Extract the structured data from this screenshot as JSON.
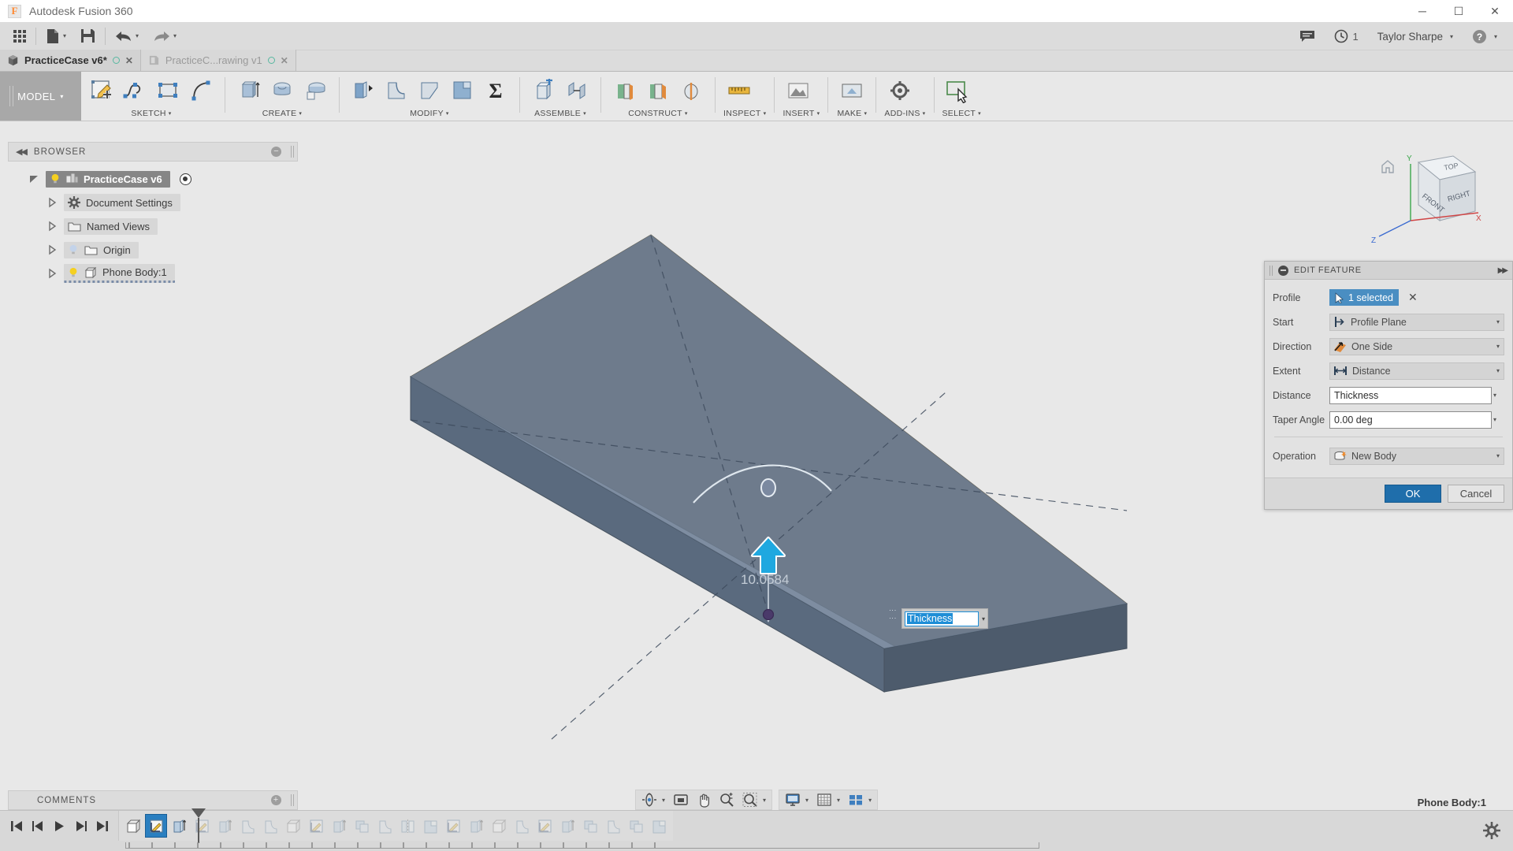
{
  "window": {
    "title": "Autodesk Fusion 360",
    "logo_glyph": "F",
    "controls": {
      "minimize": "─",
      "maximize": "☐",
      "close": "✕"
    }
  },
  "quick_access": {
    "items": [
      {
        "name": "app-grid",
        "icon": "grid-icon",
        "label": ""
      },
      {
        "name": "new-document",
        "icon": "file-icon",
        "label": "",
        "has_caret": true
      },
      {
        "name": "save",
        "icon": "save-icon",
        "label": ""
      },
      {
        "name": "undo",
        "icon": "undo-icon",
        "label": "",
        "has_caret": true
      },
      {
        "name": "redo",
        "icon": "redo-icon",
        "label": "",
        "has_caret": true
      }
    ],
    "right": {
      "comments_icon": "comment-icon",
      "jobs_icon": "clock-icon",
      "jobs_count": "1",
      "user_name": "Taylor Sharpe",
      "help_icon": "help-icon"
    }
  },
  "document_tabs": [
    {
      "label": "PracticeCase v6*",
      "active": true,
      "icon": "cube-icon",
      "status_dot": "○",
      "close": "✕"
    },
    {
      "label": "PracticeC...rawing v1",
      "active": false,
      "icon": "drawing-icon",
      "status_dot": "○",
      "close": "✕"
    }
  ],
  "ribbon": {
    "workspace": {
      "label": "MODEL",
      "caret": "▾"
    },
    "groups": [
      {
        "label": "SKETCH",
        "caret": "▾",
        "tools": [
          "create-sketch",
          "spline",
          "rectangle",
          "arc"
        ]
      },
      {
        "label": "CREATE",
        "caret": "▾",
        "tools": [
          "extrude",
          "revolve",
          "sweep"
        ]
      },
      {
        "label": "MODIFY",
        "caret": "▾",
        "tools": [
          "press-pull",
          "fillet",
          "chamfer",
          "shell",
          "combine",
          "sigma-parameters"
        ]
      },
      {
        "label": "ASSEMBLE",
        "caret": "▾",
        "tools": [
          "new-component",
          "joint"
        ]
      },
      {
        "label": "CONSTRUCT",
        "caret": "▾",
        "tools": [
          "offset-plane",
          "plane-at-angle",
          "axis"
        ]
      },
      {
        "label": "INSPECT",
        "caret": "▾",
        "tools": [
          "measure"
        ]
      },
      {
        "label": "INSERT",
        "caret": "▾",
        "tools": [
          "insert-mesh"
        ]
      },
      {
        "label": "MAKE",
        "caret": "▾",
        "tools": [
          "3d-print"
        ]
      },
      {
        "label": "ADD-INS",
        "caret": "▾",
        "tools": [
          "scripts-addins"
        ]
      },
      {
        "label": "SELECT",
        "caret": "▾",
        "tools": [
          "select-cursor"
        ]
      }
    ]
  },
  "browser": {
    "header": "BROWSER",
    "collapse_icon": "collapse-left-icon",
    "minimize_icon": "minimize-icon",
    "tree": [
      {
        "label": "PracticeCase v6",
        "depth": 0,
        "selected": true,
        "expander": "open",
        "has_bulb": true,
        "bulb": "on",
        "icon": "component-icon",
        "has_radio": true
      },
      {
        "label": "Document Settings",
        "depth": 1,
        "selected": false,
        "expander": "closed",
        "has_bulb": false,
        "icon": "gear-icon",
        "has_radio": false
      },
      {
        "label": "Named Views",
        "depth": 1,
        "selected": false,
        "expander": "closed",
        "has_bulb": false,
        "icon": "folder-icon",
        "has_radio": false
      },
      {
        "label": "Origin",
        "depth": 1,
        "selected": false,
        "expander": "closed",
        "has_bulb": true,
        "bulb": "off",
        "icon": "folder-icon",
        "has_radio": false
      },
      {
        "label": "Phone Body:1",
        "depth": 1,
        "selected": false,
        "highlighted": true,
        "expander": "closed",
        "has_bulb": true,
        "bulb": "on",
        "icon": "body-icon",
        "has_radio": false
      }
    ]
  },
  "canvas": {
    "dimension_value": "10.0584",
    "manipulator_arrow": "up-arrow-handle",
    "rotate_handle": "taper-rotate-handle",
    "input": {
      "value": "Thickness",
      "caret": "▾"
    },
    "view_cube": {
      "top": "TOP",
      "front": "FRONT",
      "right": "RIGHT",
      "axis_x": "X",
      "axis_y": "Y",
      "axis_z": "Z"
    }
  },
  "dialog": {
    "title": "EDIT FEATURE",
    "collapse_icon": "collapse-icon",
    "expand_icon": "expand-right-icon",
    "rows": [
      {
        "label": "Profile",
        "type": "selection",
        "value": "1 selected",
        "icon": "cursor-arrow-icon",
        "clear": "✕"
      },
      {
        "label": "Start",
        "type": "dropdown",
        "value": "Profile Plane",
        "icon": "profile-plane-icon"
      },
      {
        "label": "Direction",
        "type": "dropdown",
        "value": "One Side",
        "icon": "one-side-icon"
      },
      {
        "label": "Extent",
        "type": "dropdown",
        "value": "Distance",
        "icon": "distance-icon"
      },
      {
        "label": "Distance",
        "type": "textinput",
        "value": "Thickness"
      },
      {
        "label": "Taper Angle",
        "type": "textinput",
        "value": "0.00 deg"
      },
      {
        "label": "Operation",
        "type": "dropdown",
        "value": "New Body",
        "icon": "new-body-icon",
        "after_divider": true
      }
    ],
    "ok_label": "OK",
    "cancel_label": "Cancel"
  },
  "comments": {
    "label": "COMMENTS",
    "add_icon": "add-icon"
  },
  "navbar": [
    {
      "name": "orbit",
      "icon": "orbit-icon",
      "caret": true
    },
    {
      "name": "look-at",
      "icon": "look-at-icon",
      "caret": false
    },
    {
      "name": "pan",
      "icon": "pan-hand-icon",
      "caret": false
    },
    {
      "name": "zoom",
      "icon": "zoom-icon",
      "caret": false
    },
    {
      "name": "fit",
      "icon": "fit-window-icon",
      "caret": true
    },
    {
      "name": "display-settings",
      "icon": "monitor-icon",
      "caret": true
    },
    {
      "name": "grid-snaps",
      "icon": "grid-settings-icon",
      "caret": true
    },
    {
      "name": "viewports",
      "icon": "viewports-icon",
      "caret": true
    }
  ],
  "status": {
    "body_name": "Phone Body:1"
  },
  "timeline": {
    "playback": [
      {
        "name": "go-to-beginning",
        "glyph": "⏮"
      },
      {
        "name": "step-back",
        "glyph": "◀"
      },
      {
        "name": "play",
        "glyph": "▶"
      },
      {
        "name": "step-forward",
        "glyph": "▶"
      },
      {
        "name": "go-to-end",
        "glyph": "⏭"
      }
    ],
    "features": [
      {
        "name": "body-feature",
        "kind": "body",
        "active": false,
        "dim": false
      },
      {
        "name": "sketch-feature",
        "kind": "sketch",
        "active": true,
        "dim": false
      },
      {
        "name": "extrude-feature",
        "kind": "extrude",
        "active": false,
        "dim": false
      },
      {
        "name": "sketch-feature-2",
        "kind": "sketch",
        "active": false,
        "dim": true
      },
      {
        "name": "extrude-feature-2",
        "kind": "extrude",
        "active": false,
        "dim": true
      },
      {
        "name": "fillet-feature",
        "kind": "fillet",
        "active": false,
        "dim": true
      },
      {
        "name": "fillet-feature-2",
        "kind": "fillet",
        "active": false,
        "dim": true
      },
      {
        "name": "body-feature-2",
        "kind": "body",
        "active": false,
        "dim": true
      },
      {
        "name": "sketch-feature-3",
        "kind": "sketch",
        "active": false,
        "dim": true
      },
      {
        "name": "extrude-feature-3",
        "kind": "extrude",
        "active": false,
        "dim": true
      },
      {
        "name": "combine-feature",
        "kind": "combine",
        "active": false,
        "dim": true
      },
      {
        "name": "fillet-feature-3",
        "kind": "fillet",
        "active": false,
        "dim": true
      },
      {
        "name": "mirror-feature",
        "kind": "mirror",
        "active": false,
        "dim": true
      },
      {
        "name": "shell-feature",
        "kind": "shell",
        "active": false,
        "dim": true
      },
      {
        "name": "sketch-feature-4",
        "kind": "sketch",
        "active": false,
        "dim": true
      },
      {
        "name": "extrude-feature-4",
        "kind": "extrude",
        "active": false,
        "dim": true
      },
      {
        "name": "body-feature-3",
        "kind": "body",
        "active": false,
        "dim": true
      },
      {
        "name": "fillet-feature-4",
        "kind": "fillet",
        "active": false,
        "dim": true
      },
      {
        "name": "sketch-feature-5",
        "kind": "sketch",
        "active": false,
        "dim": true
      },
      {
        "name": "extrude-feature-5",
        "kind": "extrude",
        "active": false,
        "dim": true
      },
      {
        "name": "combine-feature-2",
        "kind": "combine",
        "active": false,
        "dim": true
      },
      {
        "name": "chamfer-feature",
        "kind": "fillet",
        "active": false,
        "dim": true
      },
      {
        "name": "pattern-feature",
        "kind": "combine",
        "active": false,
        "dim": true
      },
      {
        "name": "draft-feature",
        "kind": "shell",
        "active": false,
        "dim": true
      }
    ],
    "settings_icon": "gear-icon"
  },
  "colors": {
    "accent_blue": "#1f6eab",
    "selection_blue": "#4a8ec2",
    "body_face": "#6b7d94",
    "body_top": "#7a7259",
    "chrome_gray": "#e8e8e8",
    "toolbar_gray": "#dcdcdc"
  }
}
